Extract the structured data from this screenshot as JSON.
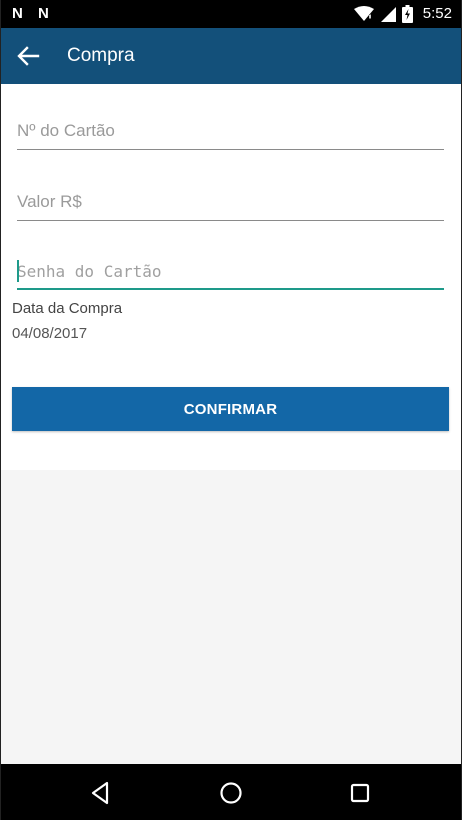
{
  "status_bar": {
    "time": "5:52",
    "left_icons": [
      "N",
      "N"
    ]
  },
  "app_bar": {
    "title": "Compra",
    "color": "#13507a"
  },
  "form": {
    "card_number": {
      "placeholder": "Nº do Cartão",
      "value": ""
    },
    "amount": {
      "placeholder": "Valor R$",
      "value": ""
    },
    "card_password": {
      "placeholder": "Senha do Cartão",
      "value": ""
    },
    "date_label": "Data da Compra",
    "date_value": "04/08/2017",
    "confirm_label": "CONFIRMAR",
    "accent_color": "#1e9a8a",
    "button_color": "#1367a7"
  },
  "icons": {
    "back": "arrow-left-icon",
    "wifi": "wifi-icon",
    "signal": "signal-icon",
    "battery": "battery-icon",
    "nav_back": "triangle-back-icon",
    "nav_home": "circle-home-icon",
    "nav_recent": "square-recent-icon"
  }
}
